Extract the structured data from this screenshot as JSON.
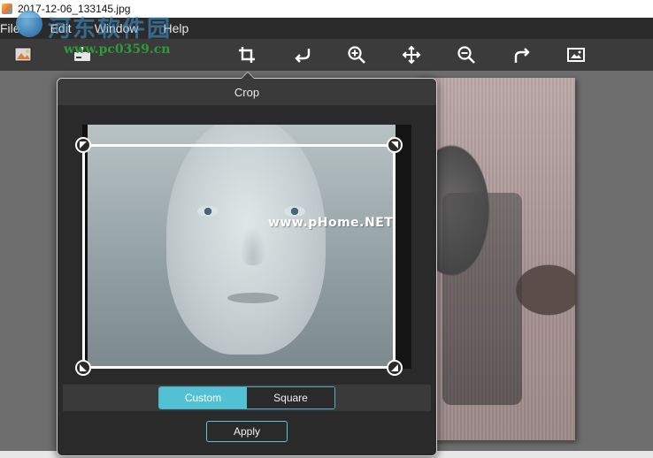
{
  "window": {
    "title": "2017-12-06_133145.jpg"
  },
  "menu": {
    "items": [
      "File",
      "Edit",
      "Window",
      "Help"
    ]
  },
  "watermark": {
    "site_name": "河东软件园",
    "url": "www.pc0359.cn",
    "inner_text": "www.pHome.NET"
  },
  "toolbar": {
    "buttons": [
      {
        "name": "image-icon"
      },
      {
        "name": "save-icon"
      },
      {
        "name": "crop-icon"
      },
      {
        "name": "undo-icon"
      },
      {
        "name": "zoom-in-icon"
      },
      {
        "name": "move-icon"
      },
      {
        "name": "zoom-out-icon"
      },
      {
        "name": "redo-icon"
      },
      {
        "name": "fit-screen-icon"
      }
    ]
  },
  "crop": {
    "title": "Crop",
    "modes": [
      "Custom",
      "Square"
    ],
    "active_mode": "Custom",
    "apply_label": "Apply"
  },
  "colors": {
    "accent": "#52c1d3",
    "menubar": "#2b2b2b",
    "toolbar": "#3b3b3b",
    "dialog": "#2a2a2a"
  }
}
